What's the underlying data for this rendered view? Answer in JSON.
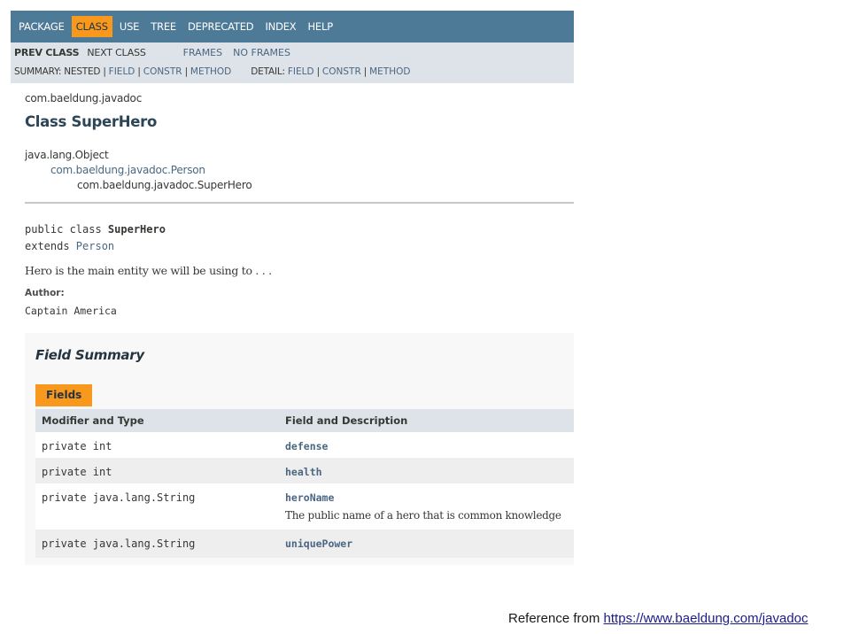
{
  "topnav": {
    "items": [
      "PACKAGE",
      "CLASS",
      "USE",
      "TREE",
      "DEPRECATED",
      "INDEX",
      "HELP"
    ],
    "active": "CLASS"
  },
  "subnav": {
    "prev_class": "PREV CLASS",
    "next_class": "NEXT CLASS",
    "frames": "FRAMES",
    "no_frames": "NO FRAMES",
    "summary_label": "SUMMARY:",
    "summary_nested": "NESTED",
    "summary_field": "FIELD",
    "summary_constr": "CONSTR",
    "summary_method": "METHOD",
    "detail_label": "DETAIL:",
    "detail_field": "FIELD",
    "detail_constr": "CONSTR",
    "detail_method": "METHOD",
    "sep": "|"
  },
  "header": {
    "package": "com.baeldung.javadoc",
    "title": "Class SuperHero"
  },
  "inheritance": {
    "level1": "java.lang.Object",
    "level2": "com.baeldung.javadoc.Person",
    "level3": "com.baeldung.javadoc.SuperHero"
  },
  "declaration": {
    "line1_prefix": "public class ",
    "line1_name": "SuperHero",
    "line2_prefix": "extends ",
    "line2_link": "Person"
  },
  "description": "Hero is the main entity we will be using to . . .",
  "author": {
    "label": "Author:",
    "value": "Captain America"
  },
  "field_summary": {
    "title": "Field Summary",
    "tab": "Fields",
    "col1": "Modifier and Type",
    "col2": "Field and Description",
    "rows": [
      {
        "type": "private int",
        "name": "defense",
        "desc": ""
      },
      {
        "type": "private int",
        "name": "health",
        "desc": ""
      },
      {
        "type": "private java.lang.String",
        "name": "heroName",
        "desc": "The public name of a hero that is common knowledge"
      },
      {
        "type": "private java.lang.String",
        "name": "uniquePower",
        "desc": ""
      }
    ]
  },
  "reference": {
    "prefix": "Reference from ",
    "url": "https://www.baeldung.com/javadoc"
  }
}
